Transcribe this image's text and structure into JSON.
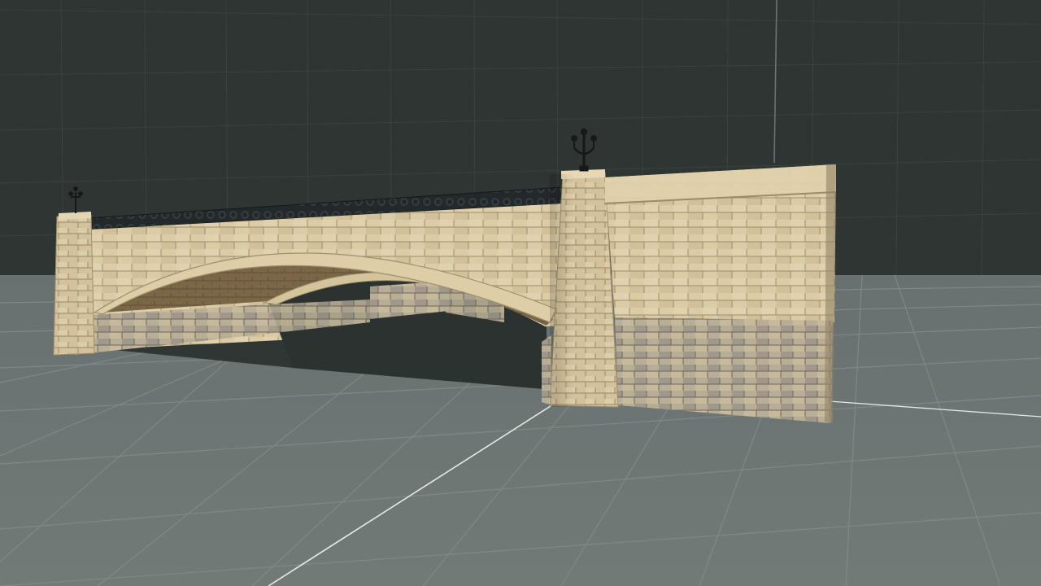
{
  "viewport": {
    "background_wall_color": "#2f3532",
    "floor_color": "#6e7672",
    "grid_line_color": "#8b9390",
    "axis_line_color": "#e6e9e7"
  },
  "model": {
    "name": "",
    "stone_color": "#d9c9a2",
    "stone_shadow_color": "#a79873",
    "underside_color": "#7e6a4d",
    "base_masonry_color": "#b7ad97",
    "railing_color": "#1f2326",
    "lamp_color": "#16181a"
  }
}
